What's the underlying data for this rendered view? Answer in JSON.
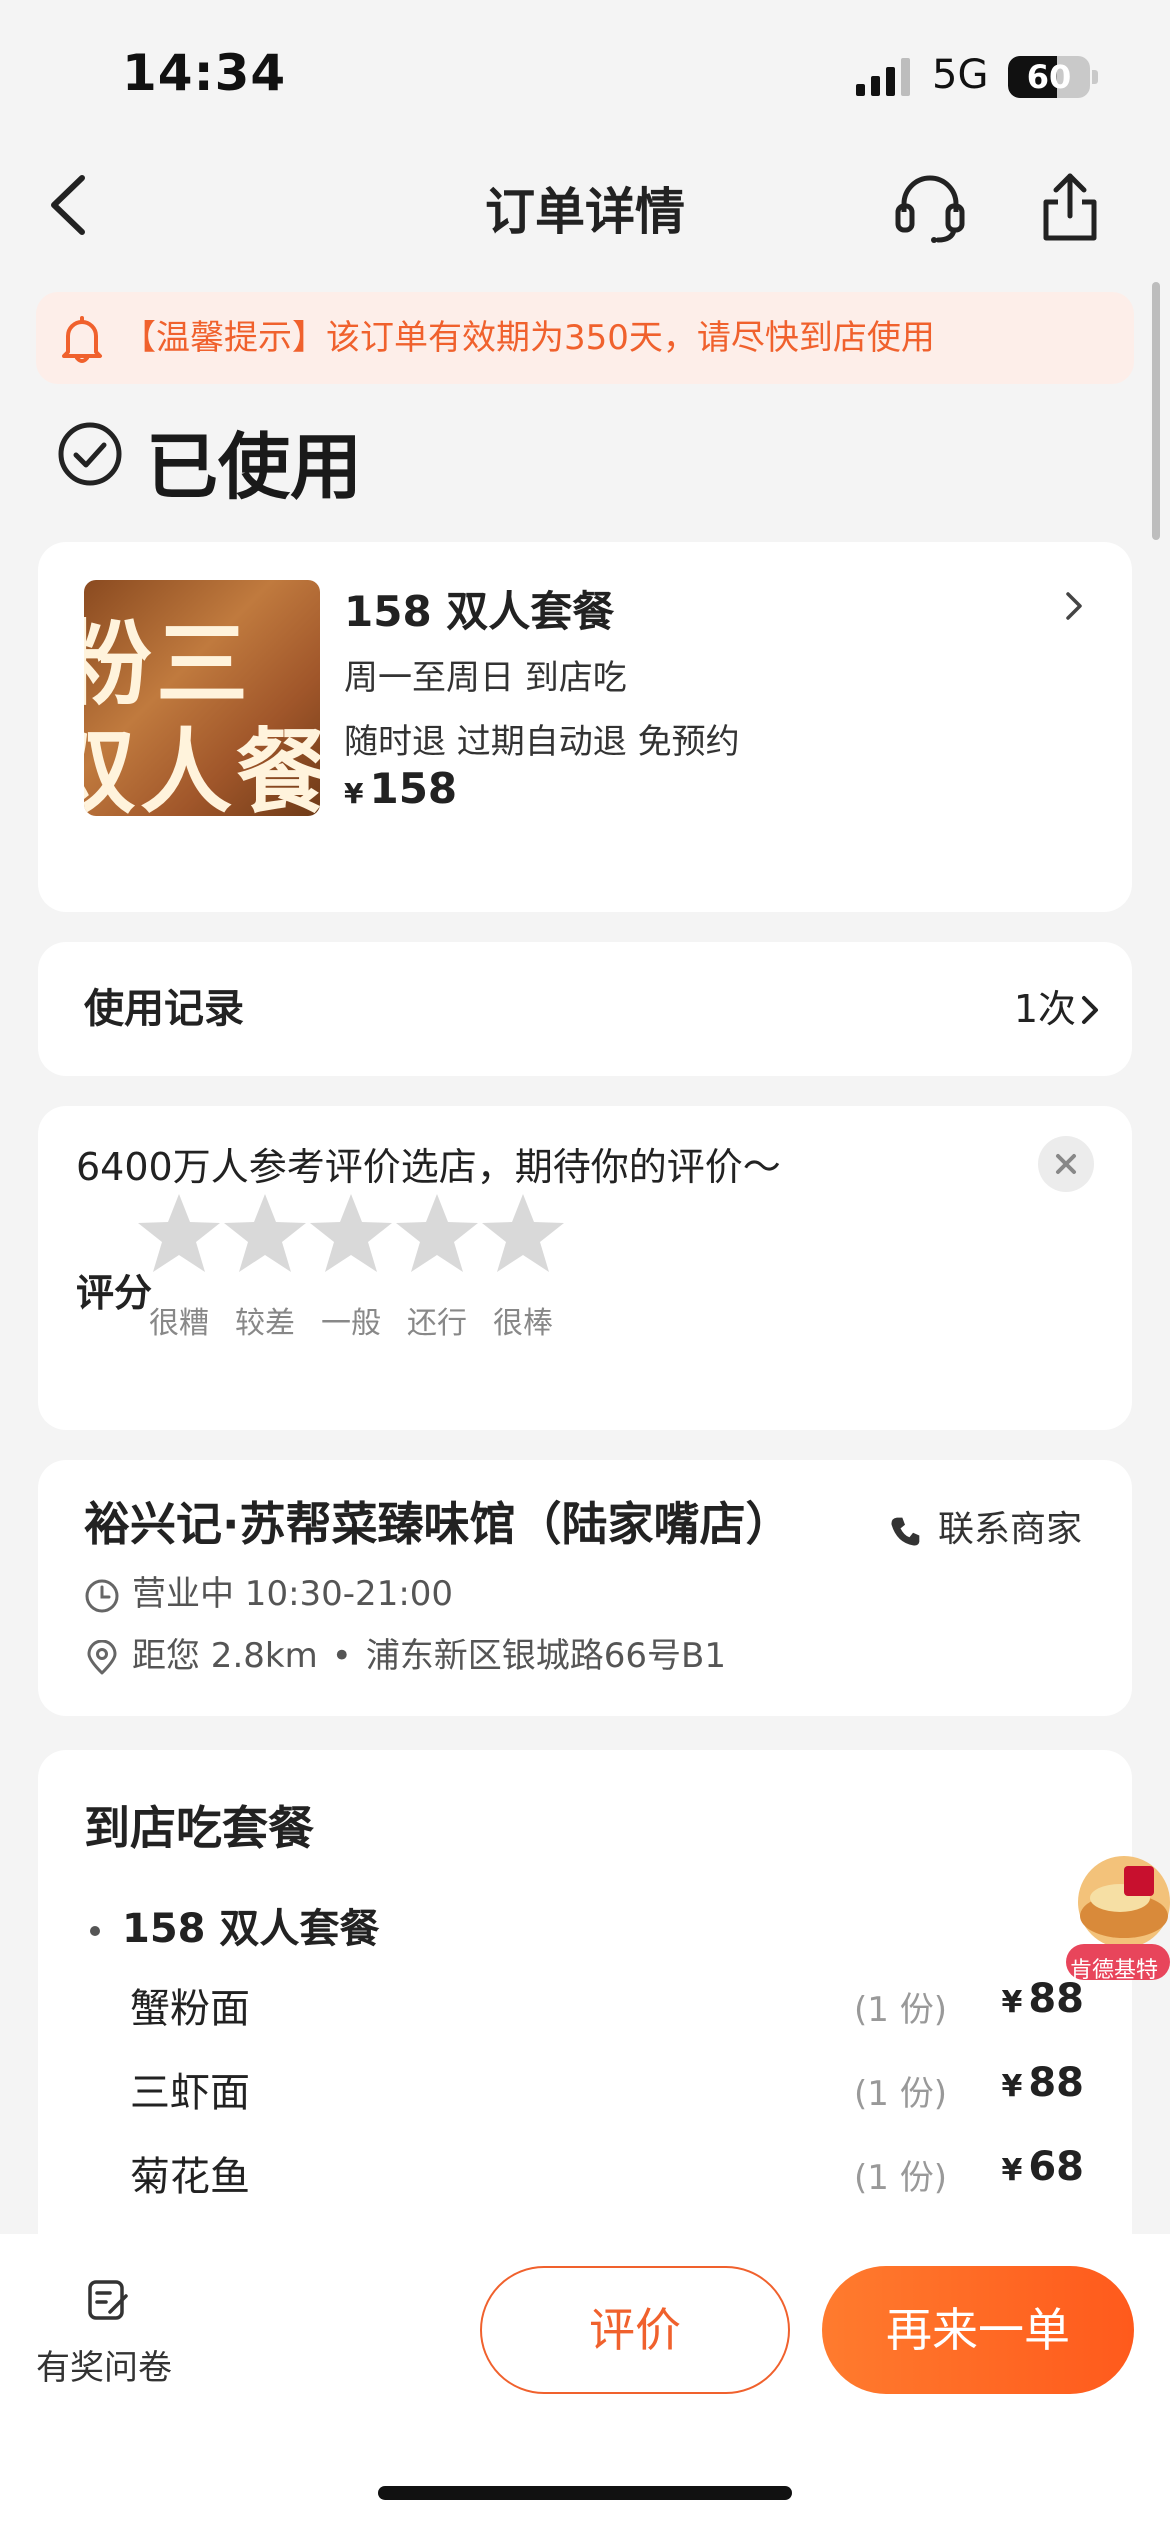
{
  "status_bar": {
    "time": "14:34",
    "network": "5G",
    "battery": "60",
    "battery_level": 0.6
  },
  "nav": {
    "title": "订单详情",
    "back_icon": "chevron-left-icon",
    "support_icon": "headset-icon",
    "share_icon": "share-icon"
  },
  "notice": {
    "text": "【温馨提示】该订单有效期为350天，请尽快到店使用",
    "icon": "bell-icon"
  },
  "order_status": {
    "text": "已使用",
    "icon": "check-circle-icon"
  },
  "product": {
    "image_text": [
      "粉三",
      "双人餐"
    ],
    "name": "158 双人套餐",
    "line1": "周一至周日   到店吃",
    "line2": "随时退   过期自动退   免预约",
    "currency": "¥",
    "price": "158"
  },
  "usage": {
    "label": "使用记录",
    "value": "1次"
  },
  "review": {
    "title": "6400万人参考评价选店，期待你的评价～",
    "score_label": "评分",
    "stars": [
      "很糟",
      "较差",
      "一般",
      "还行",
      "很棒"
    ],
    "rating": 0
  },
  "shop": {
    "name": "裕兴记·苏帮菜臻味馆（陆家嘴店）",
    "contact": "联系商家",
    "hours": "营业中 10:30-21:00",
    "distance": "距您 2.8km",
    "separator": "•",
    "address": "浦东新区银城路66号B1"
  },
  "package": {
    "title": "到店吃套餐",
    "subtitle": "158 双人套餐",
    "items": [
      {
        "name": "蟹粉面",
        "qty": "(1 份)",
        "currency": "¥",
        "price": "88"
      },
      {
        "name": "三虾面",
        "qty": "(1 份)",
        "currency": "¥",
        "price": "88"
      },
      {
        "name": "菊花鱼",
        "qty": "(1 份)",
        "currency": "¥",
        "price": "68"
      }
    ]
  },
  "floating_ad": {
    "label": "肯德基特"
  },
  "bottom_bar": {
    "survey_label": "有奖问卷",
    "review_button": "评价",
    "reorder_button": "再来一单"
  },
  "colors": {
    "accent": "#f0612d",
    "background": "#f4f4f4",
    "star_empty": "#d9d9d9"
  }
}
